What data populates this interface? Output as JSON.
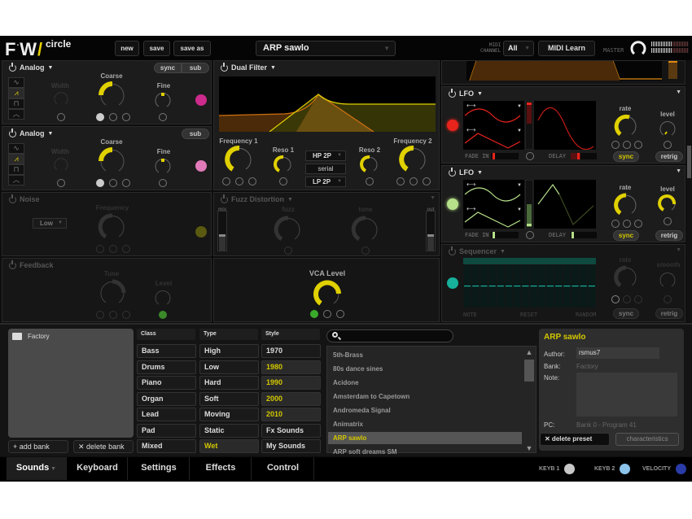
{
  "app": {
    "logo": "FAW",
    "product": "circle",
    "buttons": {
      "new": "new",
      "save": "save",
      "save_as": "save as",
      "midi_learn": "MIDI Learn"
    },
    "preset_name": "ARP sawlo",
    "midi_channel_label": "MIDI CHANNEL",
    "midi_channel_value": "All",
    "master_label": "MASTER"
  },
  "oscillators": [
    {
      "title": "Analog",
      "buttons": [
        "sync",
        "sub"
      ],
      "waveforms": [
        "sine",
        "saw",
        "square",
        "triangle"
      ],
      "active_waveform": "saw",
      "width_label": "Width",
      "coarse_label": "Coarse",
      "fine_label": "Fine",
      "color": "#cc2a8c"
    },
    {
      "title": "Analog",
      "buttons": [
        "sub"
      ],
      "waveforms": [
        "sine",
        "saw",
        "square",
        "triangle"
      ],
      "active_waveform": "saw",
      "width_label": "Width",
      "coarse_label": "Coarse",
      "fine_label": "Fine",
      "color": "#e07ab8"
    }
  ],
  "noise": {
    "title": "Noise",
    "mode": "Low",
    "frequency_label": "Frequency",
    "color": "#5a5a10"
  },
  "feedback": {
    "title": "Feedback",
    "tune_label": "Tune",
    "level_label": "Level"
  },
  "dual_filter": {
    "title": "Dual Filter",
    "freq1_label": "Frequency 1",
    "reso1_label": "Reso 1",
    "reso2_label": "Reso 2",
    "freq2_label": "Frequency 2",
    "filter1_type": "HP 2P",
    "routing": "serial",
    "filter2_type": "LP 2P"
  },
  "fuzz": {
    "title": "Fuzz Distortion",
    "mix_label": "mix",
    "fuzz_label": "fuzz",
    "tone_label": "tone",
    "out_label": "out"
  },
  "vca": {
    "label": "VCA Level"
  },
  "lfo1": {
    "title": "LFO",
    "rate_label": "rate",
    "level_label": "level",
    "fade_in_label": "FADE IN",
    "delay_label": "DELAY",
    "sync_label": "sync",
    "retrig_label": "retrig",
    "color": "#e8241c"
  },
  "lfo2": {
    "title": "LFO",
    "rate_label": "rate",
    "level_label": "level",
    "fade_in_label": "FADE IN",
    "delay_label": "DELAY",
    "sync_label": "sync",
    "retrig_label": "retrig",
    "color": "#b6e08a"
  },
  "sequencer": {
    "title": "Sequencer",
    "rate_label": "rate",
    "smooth_label": "smooth",
    "note_label": "NOTE",
    "reset_label": "RESET",
    "random_label": "RANDOM",
    "sync_label": "sync",
    "retrig_label": "retrig",
    "color": "#17b09a",
    "steps": 16
  },
  "browser": {
    "bank": "Factory",
    "add_bank": "+ add bank",
    "delete_bank": "✕ delete bank",
    "columns": [
      {
        "header": "Class",
        "items": [
          "Bass",
          "Drums",
          "Piano",
          "Organ",
          "Lead",
          "Pad",
          "Mixed"
        ],
        "highlighted": []
      },
      {
        "header": "Type",
        "items": [
          "High",
          "Low",
          "Hard",
          "Soft",
          "Moving",
          "Static",
          "Wet"
        ],
        "highlighted": [
          "Wet"
        ]
      },
      {
        "header": "Style",
        "items": [
          "1970",
          "1980",
          "1990",
          "2000",
          "2010",
          "Fx Sounds",
          "My Sounds"
        ],
        "highlighted": [
          "1980",
          "1990",
          "2000",
          "2010"
        ]
      }
    ],
    "search_placeholder": "",
    "presets": [
      "5th-Brass",
      "80s dance sines",
      "Acidone",
      "Amsterdam to Capetown",
      "Andromeda Signal",
      "Animatrix",
      "ARP sawlo",
      "ARP soft dreams SM"
    ],
    "selected_preset": "ARP sawlo"
  },
  "preset_info": {
    "name": "ARP sawlo",
    "author_label": "Author:",
    "author": "rsmus7",
    "bank_label": "Bank:",
    "bank": "Factory",
    "note_label": "Note:",
    "note": "",
    "pc_label": "PC:",
    "pc": "Bank 0 - Program 41",
    "delete_preset": "✕ delete preset",
    "characteristics": "characteristics"
  },
  "tabs": [
    {
      "label": "Sounds",
      "active": true
    },
    {
      "label": "Keyboard",
      "active": false
    },
    {
      "label": "Settings",
      "active": false
    },
    {
      "label": "Effects",
      "active": false
    },
    {
      "label": "Control",
      "active": false
    }
  ],
  "indicators": [
    {
      "label": "KEYB 1",
      "color": "#c8c8c8"
    },
    {
      "label": "KEYB 2",
      "color": "#8cc4ec"
    },
    {
      "label": "VELOCITY",
      "color": "#2a3ca8"
    }
  ],
  "colors": {
    "accent": "#e0d000",
    "envelope": "#e08a10"
  }
}
